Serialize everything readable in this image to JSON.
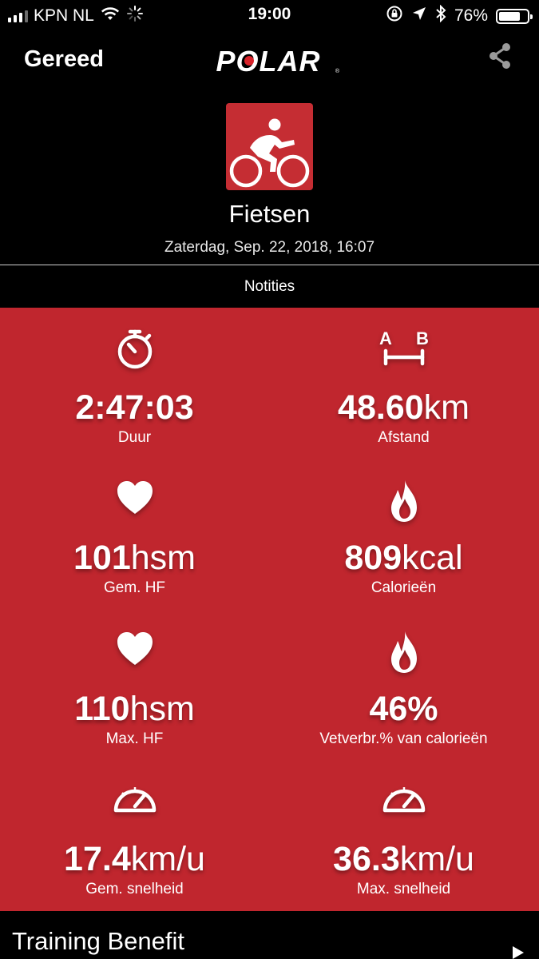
{
  "status_bar": {
    "carrier": "KPN NL",
    "time": "19:00",
    "battery_percent": "76%",
    "battery_level": 0.76,
    "icons": [
      "signal-icon",
      "wifi-icon",
      "activity-spinner-icon",
      "rotation-lock-icon",
      "location-icon",
      "bluetooth-icon",
      "battery-icon"
    ]
  },
  "nav": {
    "done_label": "Gereed",
    "logo_text": "POLAR",
    "share_icon": "share-icon"
  },
  "session": {
    "sport_icon": "cycling-icon",
    "sport_name": "Fietsen",
    "date": "Zaterdag, Sep. 22, 2018, 16:07",
    "notes_label": "Notities"
  },
  "stats": [
    {
      "icon": "stopwatch-icon",
      "value": "2:47:03",
      "unit": "",
      "label": "Duur"
    },
    {
      "icon": "distance-ab-icon",
      "value": "48.60",
      "unit": "km",
      "label": "Afstand"
    },
    {
      "icon": "heart-icon",
      "value": "101",
      "unit": "hsm",
      "label": "Gem. HF"
    },
    {
      "icon": "flame-icon",
      "value": "809",
      "unit": "kcal",
      "label": "Calorieën"
    },
    {
      "icon": "heart-icon",
      "value": "110",
      "unit": "hsm",
      "label": "Max. HF"
    },
    {
      "icon": "flame-icon",
      "value": "46%",
      "unit": "",
      "label": "Vetverbr.% van calorieën"
    },
    {
      "icon": "speedometer-icon",
      "value": "17.4",
      "unit": "km/u",
      "label": "Gem. snelheid"
    },
    {
      "icon": "speedometer-icon",
      "value": "36.3",
      "unit": "km/u",
      "label": "Max. snelheid"
    }
  ],
  "training_benefit": {
    "title": "Training Benefit"
  },
  "colors": {
    "background": "#000000",
    "stats_panel": "#c0262e",
    "sport_tile": "#c52d33",
    "text": "#ffffff"
  }
}
